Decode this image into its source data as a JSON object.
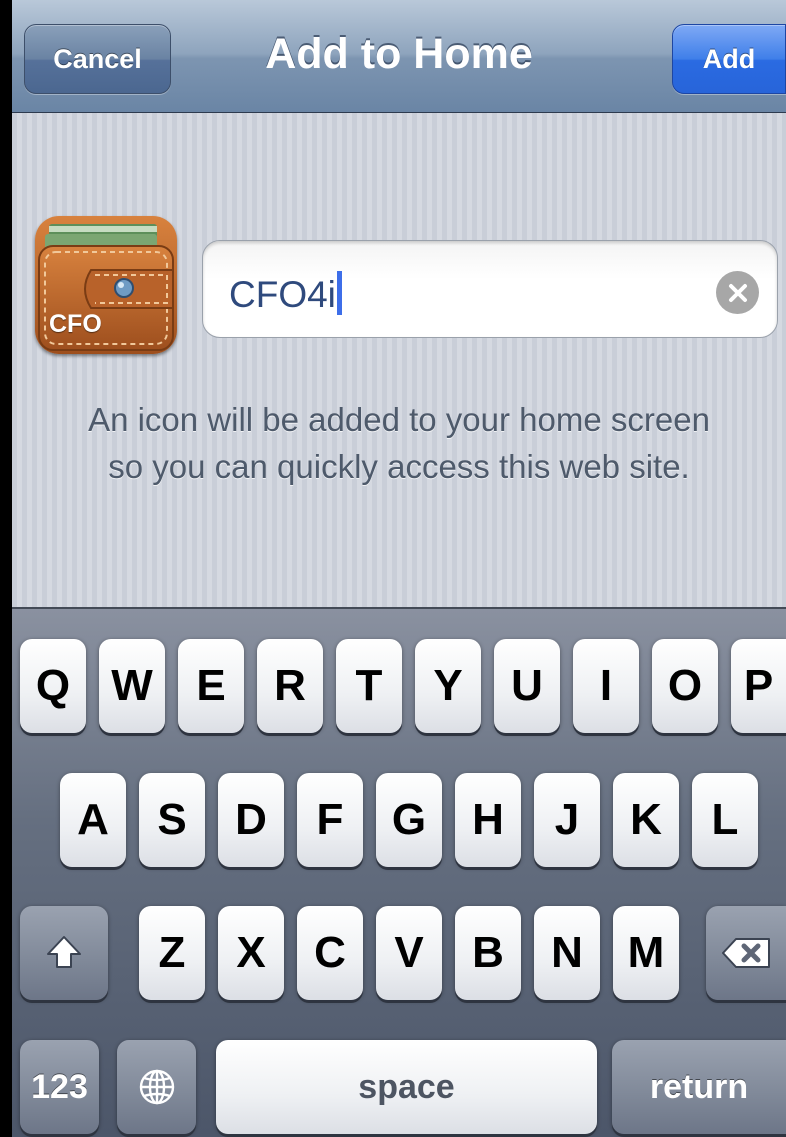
{
  "nav": {
    "title": "Add to Home",
    "cancel_label": "Cancel",
    "add_label": "Add"
  },
  "app_icon": {
    "label": "CFO",
    "name": "wallet-icon"
  },
  "name_field": {
    "value": "CFO4i",
    "clear_icon": "clear-icon"
  },
  "hint": {
    "line1": "An icon will be added to your home screen",
    "line2": "so you can quickly access this web site."
  },
  "keyboard": {
    "row1": [
      "Q",
      "W",
      "E",
      "R",
      "T",
      "Y",
      "U",
      "I",
      "O",
      "P"
    ],
    "row2": [
      "A",
      "S",
      "D",
      "F",
      "G",
      "H",
      "J",
      "K",
      "L"
    ],
    "row3": [
      "Z",
      "X",
      "C",
      "V",
      "B",
      "N",
      "M"
    ],
    "shift_icon": "shift-icon",
    "delete_icon": "backspace-icon",
    "numbers_label": "123",
    "globe_icon": "globe-icon",
    "space_label": "space",
    "return_label": "return"
  },
  "colors": {
    "accent": "#2b6be2",
    "nav_bar": "#7d95b1",
    "text_field": "#2f4a7d"
  }
}
